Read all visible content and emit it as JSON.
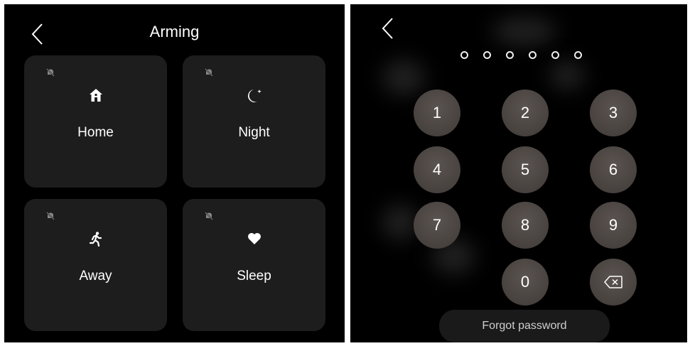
{
  "arming": {
    "title": "Arming",
    "modes": [
      {
        "label": "Home"
      },
      {
        "label": "Night"
      },
      {
        "label": "Away"
      },
      {
        "label": "Sleep"
      }
    ]
  },
  "keypad": {
    "pin_dot_count": 6,
    "keys": [
      "1",
      "2",
      "3",
      "4",
      "5",
      "6",
      "7",
      "8",
      "9",
      "0"
    ],
    "forgot_label": "Forgot password"
  },
  "icons": {
    "back": "chevron-left-icon",
    "mute": "bell-off-icon",
    "home": "house-icon",
    "night": "moon-star-icon",
    "away": "running-person-icon",
    "sleep": "heart-icon",
    "backspace": "backspace-icon"
  }
}
